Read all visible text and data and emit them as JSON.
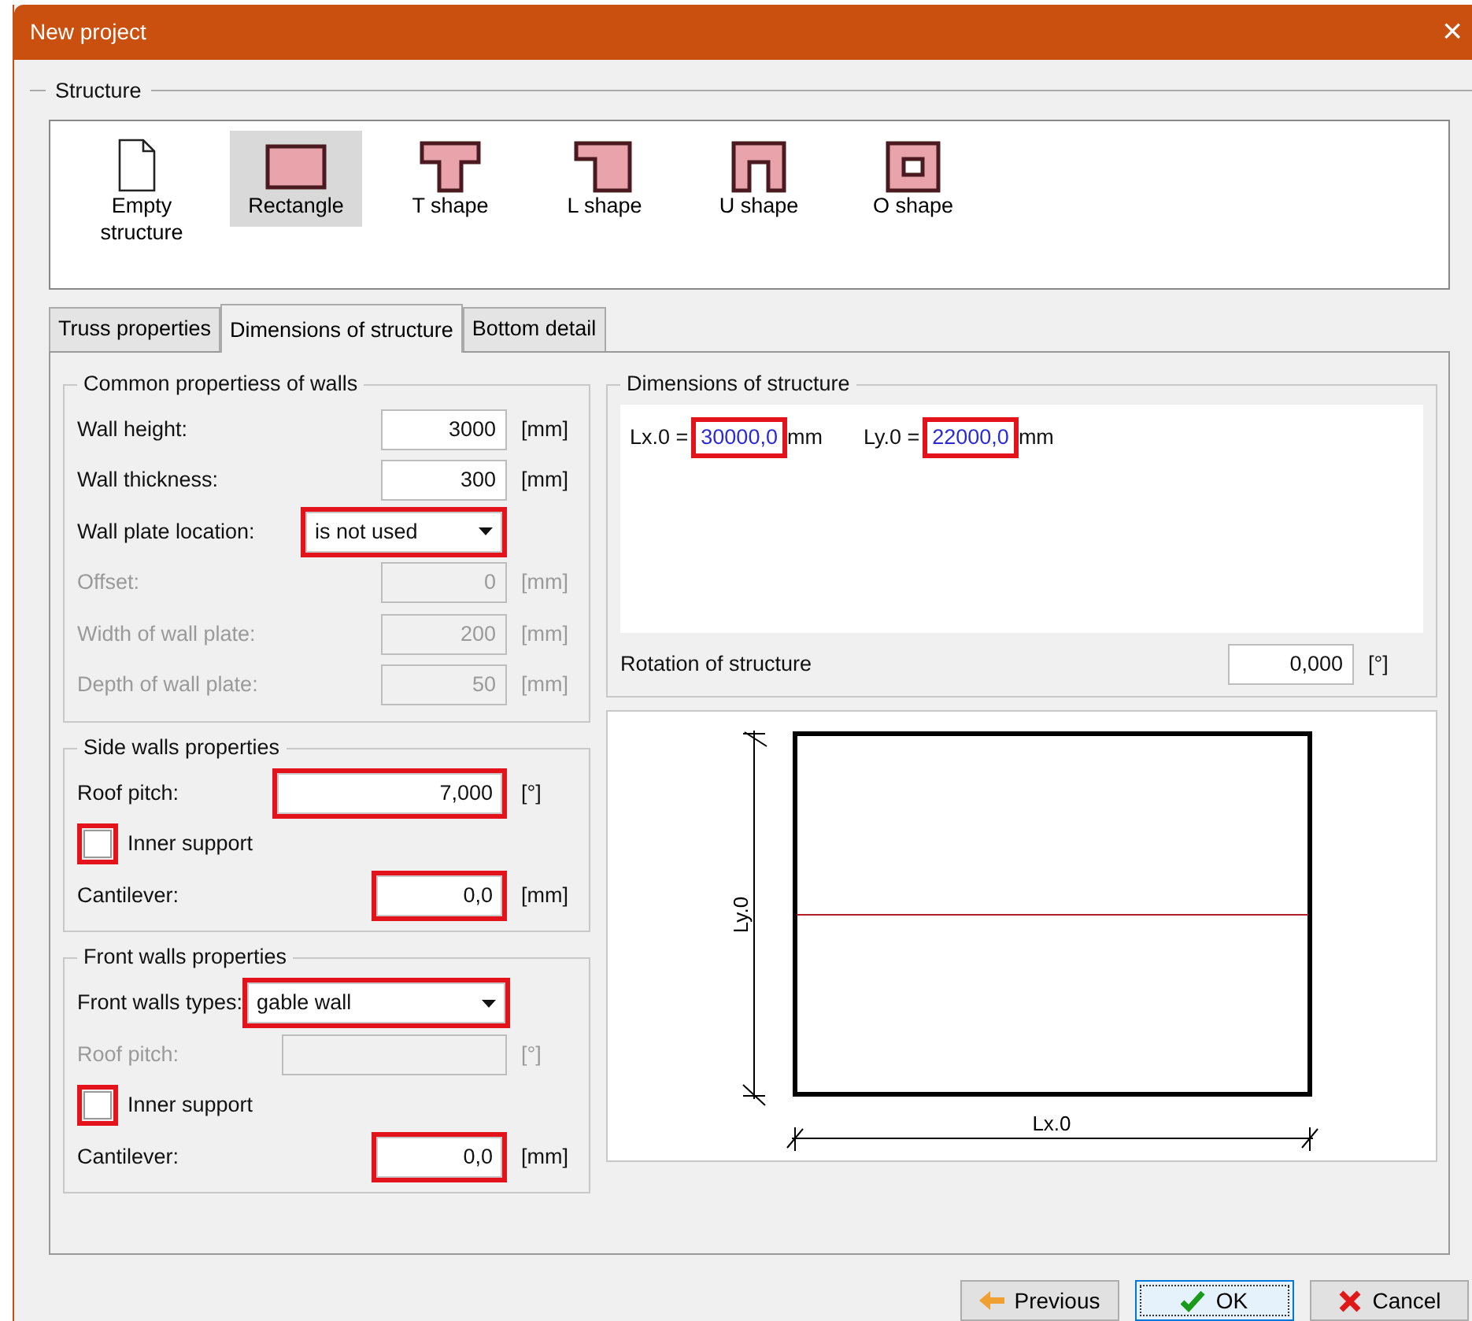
{
  "window": {
    "title": "New project",
    "close": "×"
  },
  "structure": {
    "legend": "Structure",
    "shapes": [
      {
        "label": "Empty structure",
        "kind": "empty",
        "selected": false
      },
      {
        "label": "Rectangle",
        "kind": "rectangle",
        "selected": true
      },
      {
        "label": "T shape",
        "kind": "t",
        "selected": false
      },
      {
        "label": "L shape",
        "kind": "l",
        "selected": false
      },
      {
        "label": "U shape",
        "kind": "u",
        "selected": false
      },
      {
        "label": "O shape",
        "kind": "o",
        "selected": false
      }
    ]
  },
  "tabs": [
    {
      "label": "Truss properties",
      "selected": false
    },
    {
      "label": "Dimensions of structure",
      "selected": true
    },
    {
      "label": "Bottom detail",
      "selected": false
    }
  ],
  "groups": [
    {
      "legend": "Common propertiess of walls",
      "rows": [
        {
          "kind": "input",
          "label": "Wall height:",
          "value": "3000",
          "unit": "[mm]",
          "disabled": false,
          "highlighted": false
        },
        {
          "kind": "input",
          "label": "Wall thickness:",
          "value": "300",
          "unit": "[mm]",
          "disabled": false,
          "highlighted": false
        },
        {
          "kind": "select",
          "label": "Wall plate location:",
          "value": "is not used",
          "disabled": false,
          "highlighted": true
        },
        {
          "kind": "input",
          "label": "Offset:",
          "value": "0",
          "unit": "[mm]",
          "disabled": true,
          "highlighted": false
        },
        {
          "kind": "input",
          "label": "Width of wall plate:",
          "value": "200",
          "unit": "[mm]",
          "disabled": true,
          "highlighted": false
        },
        {
          "kind": "input",
          "label": "Depth of wall plate:",
          "value": "50",
          "unit": "[mm]",
          "disabled": true,
          "highlighted": false
        }
      ]
    },
    {
      "legend": "Side walls properties",
      "rows": [
        {
          "kind": "wide",
          "label": "Roof pitch:",
          "value": "7,000",
          "unit": "[°]",
          "disabled": false,
          "highlighted": true
        },
        {
          "kind": "checkbox",
          "label": "Inner support",
          "checked": false,
          "highlighted": true
        },
        {
          "kind": "input",
          "label": "Cantilever:",
          "value": "0,0",
          "unit": "[mm]",
          "disabled": false,
          "highlighted": true
        }
      ]
    },
    {
      "legend": "Front walls properties",
      "rows": [
        {
          "kind": "wideselect",
          "label": "Front walls types:",
          "value": "gable wall",
          "disabled": false,
          "highlighted": true
        },
        {
          "kind": "wide",
          "label": "Roof pitch:",
          "unit": "[°]",
          "disabled": true,
          "highlighted": false
        },
        {
          "kind": "checkbox",
          "label": "Inner support",
          "checked": false,
          "highlighted": true
        },
        {
          "kind": "input",
          "label": "Cantilever:",
          "value": "0,0",
          "unit": "[mm]",
          "disabled": false,
          "highlighted": true
        }
      ]
    }
  ],
  "dimensions": {
    "legend": "Dimensions of structure",
    "items": [
      {
        "label": "Lx.0 =",
        "value": "30000,0",
        "unit": "mm",
        "highlighted": true
      },
      {
        "label": "Ly.0 =",
        "value": "22000,0",
        "unit": "mm",
        "highlighted": true
      }
    ],
    "rotation": {
      "label": "Rotation of structure",
      "value": "0,000",
      "unit": "[°]"
    }
  },
  "drawing": {
    "ylabel": "Ly.0",
    "xlabel": "Lx.0"
  },
  "buttons": [
    {
      "label": "Previous",
      "kind": "previous",
      "focused": false
    },
    {
      "label": "OK",
      "kind": "ok",
      "focused": true
    },
    {
      "label": "Cancel",
      "kind": "cancel",
      "focused": false
    }
  ]
}
